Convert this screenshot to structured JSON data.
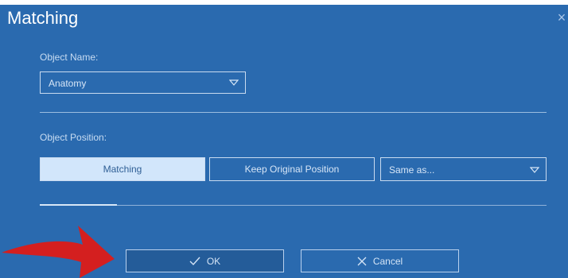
{
  "dialog": {
    "title": "Matching",
    "close_icon": "close-icon"
  },
  "object_name": {
    "label": "Object Name:",
    "value": "Anatomy",
    "caret_icon": "chevron-down-icon"
  },
  "object_position": {
    "label": "Object Position:",
    "options": [
      {
        "label": "Matching",
        "selected": true
      },
      {
        "label": "Keep Original Position",
        "selected": false
      }
    ],
    "same_as": {
      "value": "Same as...",
      "caret_icon": "chevron-down-icon"
    }
  },
  "buttons": {
    "ok": {
      "label": "OK",
      "icon": "check-icon"
    },
    "cancel": {
      "label": "Cancel",
      "icon": "close-icon"
    }
  },
  "annotation": {
    "arrow_icon": "red-arrow-icon",
    "color": "#d41f1f"
  },
  "colors": {
    "dialog_bg": "#2a6aaf",
    "active_segment": "#d2e6fb",
    "ok_bg": "#245c99"
  }
}
